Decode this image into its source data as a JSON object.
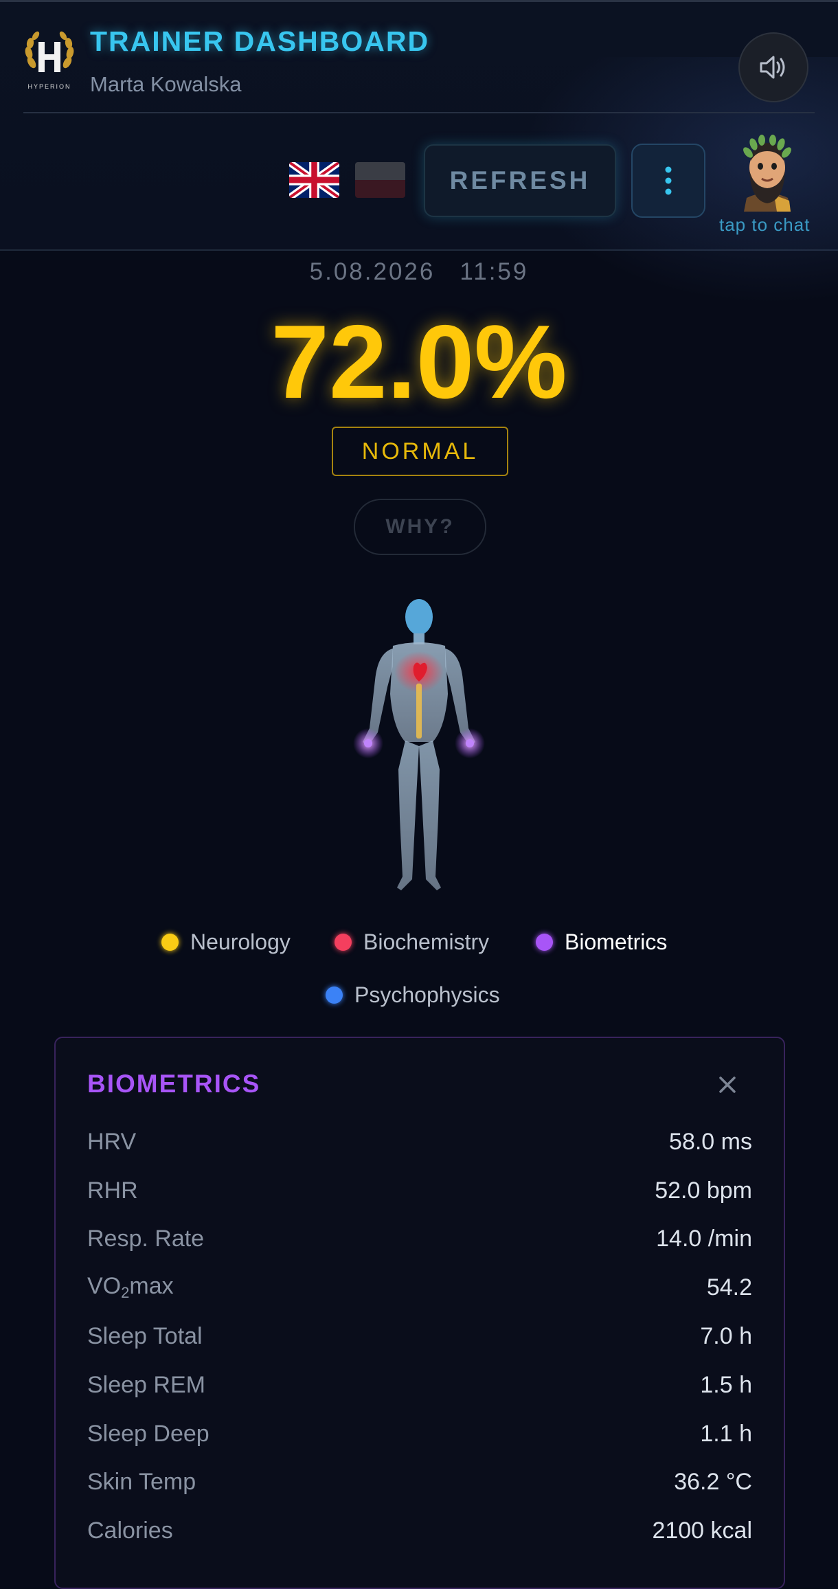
{
  "header": {
    "logo_text": "HYPERION",
    "title": "TRAINER DASHBOARD",
    "subtitle": "Marta Kowalska",
    "sound_icon": "speaker-icon",
    "languages": [
      {
        "code": "en",
        "icon": "uk-flag-icon"
      },
      {
        "code": "pl",
        "icon": "pl-flag-icon"
      }
    ],
    "refresh_label": "REFRESH",
    "menu_icon": "vertical-dots-icon",
    "avatar_caption": "tap to chat"
  },
  "summary": {
    "date": "5.08.2026",
    "time": "11:59",
    "score": "72.0%",
    "status": "NORMAL",
    "why_label": "WHY?"
  },
  "legend": [
    {
      "label": "Neurology",
      "color": "#facc15"
    },
    {
      "label": "Biochemistry",
      "color": "#f43f5e"
    },
    {
      "label": "Biometrics",
      "color": "#a855f7",
      "active": true
    },
    {
      "label": "Psychophysics",
      "color": "#3b82f6"
    }
  ],
  "panel": {
    "title": "BIOMETRICS",
    "close_icon": "close-icon",
    "rows": [
      {
        "label": "HRV",
        "value": "58.0 ms"
      },
      {
        "label": "RHR",
        "value": "52.0 bpm"
      },
      {
        "label": "Resp. Rate",
        "value": "14.0 /min"
      },
      {
        "label_main": "VO",
        "label_sub": "2",
        "label_tail": "max",
        "value": "54.2"
      },
      {
        "label": "Sleep Total",
        "value": "7.0 h"
      },
      {
        "label": "Sleep REM",
        "value": "1.5 h"
      },
      {
        "label": "Sleep Deep",
        "value": "1.1 h"
      },
      {
        "label": "Skin Temp",
        "value": "36.2 °C"
      },
      {
        "label": "Calories",
        "value": "2100 kcal"
      }
    ]
  }
}
